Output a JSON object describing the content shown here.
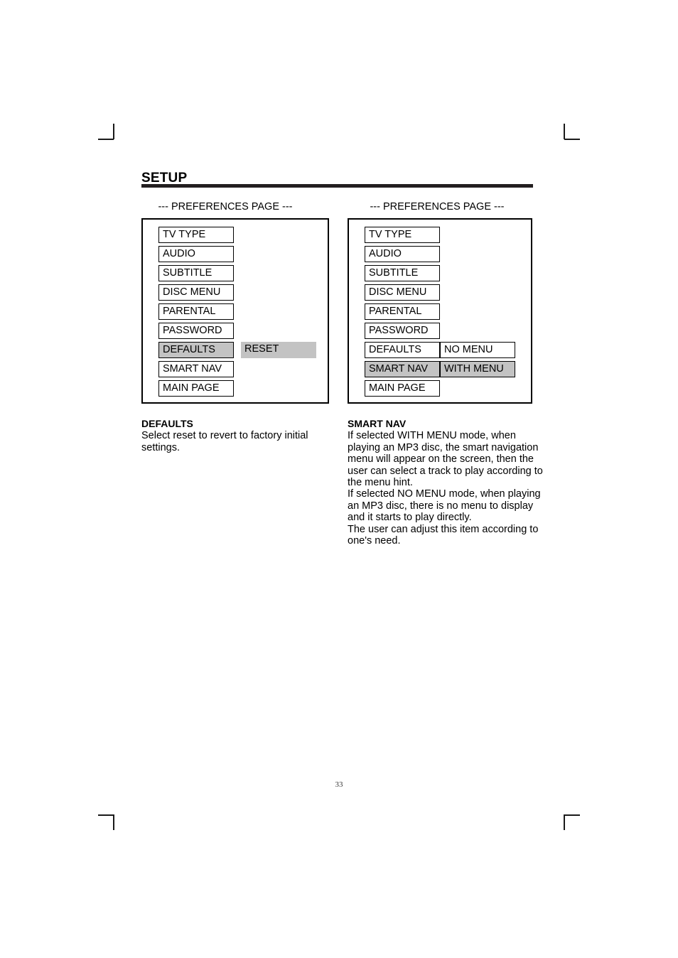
{
  "heading": "SETUP",
  "folio": "33",
  "colors": {
    "highlight": "#c3c3c3",
    "rule": "#231f20",
    "text": "#000000"
  },
  "panels": [
    {
      "id": "defaults-panel",
      "screen_title": "--- PREFERENCES PAGE ---",
      "menu_items": [
        {
          "label": "TV TYPE",
          "selected": false
        },
        {
          "label": "AUDIO",
          "selected": false
        },
        {
          "label": "SUBTITLE",
          "selected": false
        },
        {
          "label": "DISC MENU",
          "selected": false
        },
        {
          "label": "PARENTAL",
          "selected": false
        },
        {
          "label": "PASSWORD",
          "selected": false
        },
        {
          "label": "DEFAULTS",
          "selected": true
        },
        {
          "label": "SMART NAV",
          "selected": false
        },
        {
          "label": "MAIN PAGE",
          "selected": false
        }
      ],
      "options": [
        {
          "label": "RESET",
          "selected": true,
          "bordered": false
        }
      ],
      "description": {
        "title": "DEFAULTS",
        "body": "Select reset to revert to factory initial settings."
      }
    },
    {
      "id": "smart-nav-panel",
      "screen_title": "--- PREFERENCES PAGE ---",
      "menu_items": [
        {
          "label": "TV TYPE",
          "selected": false
        },
        {
          "label": "AUDIO",
          "selected": false
        },
        {
          "label": "SUBTITLE",
          "selected": false
        },
        {
          "label": "DISC MENU",
          "selected": false
        },
        {
          "label": "PARENTAL",
          "selected": false
        },
        {
          "label": "PASSWORD",
          "selected": false
        },
        {
          "label": "DEFAULTS",
          "selected": false
        },
        {
          "label": "SMART NAV",
          "selected": true
        },
        {
          "label": "MAIN PAGE",
          "selected": false
        }
      ],
      "options": [
        {
          "label": "NO MENU",
          "selected": false,
          "bordered": true
        },
        {
          "label": "WITH MENU",
          "selected": true,
          "bordered": true
        }
      ],
      "description": {
        "title": "SMART NAV",
        "paragraphs": [
          "If selected WITH MENU mode, when playing an MP3 disc, the smart navigation menu will appear on the screen, then the user can select a track to play according to the menu hint.",
          "If selected NO MENU mode, when playing an MP3 disc, there is no menu to display and it starts to play directly.",
          "The user can adjust this item according to one's need."
        ]
      }
    }
  ]
}
